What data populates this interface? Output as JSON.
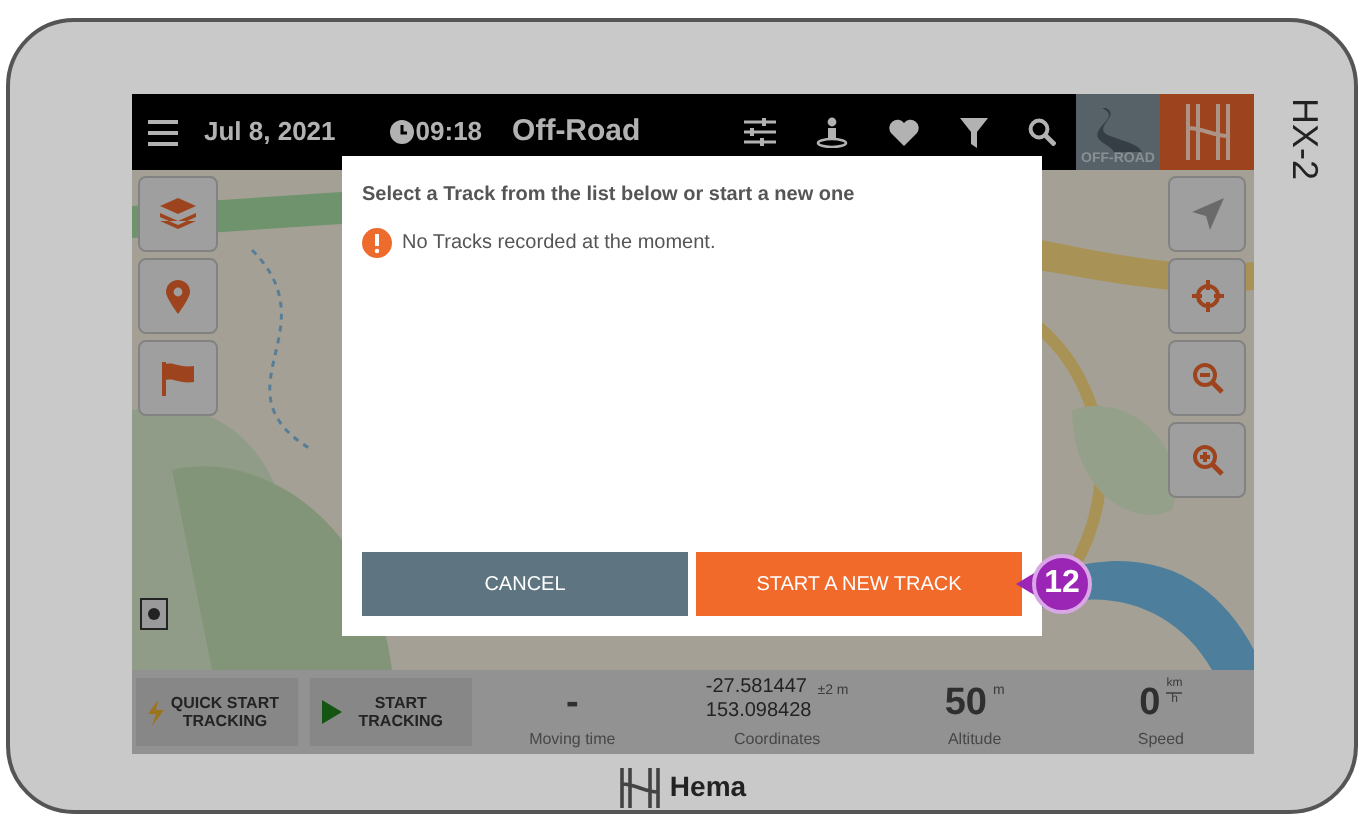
{
  "device": {
    "model": "HX-2",
    "brand": "Hema"
  },
  "top_bar": {
    "date": "Jul 8, 2021",
    "time": "09:18",
    "mode": "Off-Road",
    "mode_tile": "OFF-ROAD"
  },
  "dialog": {
    "title": "Select a Track from the list below or start a new one",
    "message": "No Tracks recorded at the moment.",
    "buttons": [
      {
        "label": "CANCEL",
        "kind": "secondary"
      },
      {
        "label": "START A NEW TRACK",
        "kind": "primary"
      }
    ]
  },
  "callout": "12",
  "bottom_bar": {
    "buttons": [
      {
        "label": "QUICK START TRACKING",
        "kind": "quick"
      },
      {
        "label": "START TRACKING",
        "kind": "start"
      }
    ],
    "stats": [
      {
        "kind": "plain",
        "value": "-",
        "label": "Moving time"
      },
      {
        "kind": "coords",
        "lines": [
          "-27.581447",
          "153.098428"
        ],
        "unit": "±2 m",
        "label": "Coordinates"
      },
      {
        "kind": "plain",
        "value": "50",
        "unit": "m",
        "label": "Altitude"
      },
      {
        "kind": "fraction",
        "value": "0",
        "unit_top": "km",
        "unit_bottom": "h",
        "label": "Speed"
      }
    ]
  }
}
